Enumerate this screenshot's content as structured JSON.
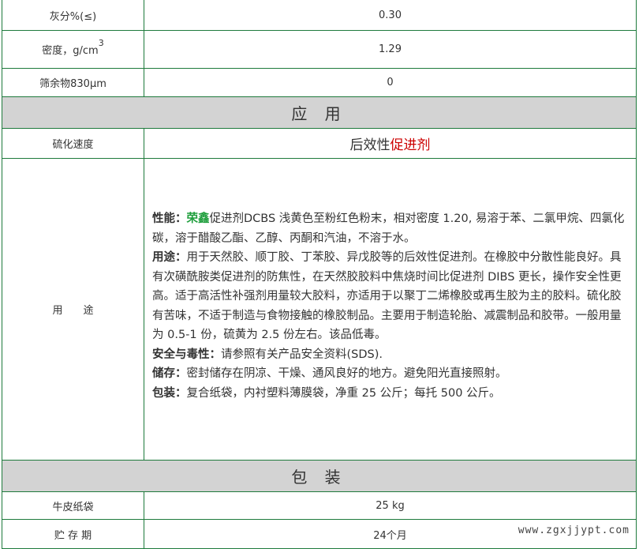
{
  "rows_top": [
    {
      "label": "灰分%(≤)",
      "value": "0.30"
    },
    {
      "label": "密度，g/cm",
      "sup": "3",
      "value": "1.29"
    },
    {
      "label": "筛余物830μm",
      "value": "0"
    }
  ],
  "section_application": "应 用",
  "vulcanization": {
    "label": "硫化速度",
    "value_a": "后效性",
    "value_b": "促进剂"
  },
  "usage": {
    "label": "用　　途",
    "p1_key": "性能：",
    "p1_brand": "荣鑫",
    "p1_text": "促进剂DCBS 浅黄色至粉红色粉末，相对密度 1.20, 易溶于苯、二氯甲烷、四氯化碳，溶于醋酸乙酯、乙醇、丙酮和汽油，不溶于水。",
    "p2_key": "用途：",
    "p2_text": "用于天然胶、顺丁胶、丁苯胶、异戊胶等的后效性促进剂。在橡胶中分散性能良好。具有次磺酰胺类促进剂的防焦性，在天然胶胶料中焦烧时间比促进剂 DIBS 更长，操作安全性更高。适于高活性补强剂用量较大胶料，亦适用于以聚丁二烯橡胶或再生胶为主的胶料。硫化胶有苦味，不适于制造与食物接触的橡胶制品。主要用于制造轮胎、减震制品和胶带。一般用量为 0.5-1 份，硫黄为 2.5 份左右。该品低毒。",
    "p3_key": "安全与毒性：",
    "p3_text": "请参照有关产品安全资料(SDS).",
    "p4_key": "储存：",
    "p4_text": "密封储存在阴凉、干燥、通风良好的地方。避免阳光直接照射。",
    "p5_key": "包装：",
    "p5_text": "复合纸袋，内衬塑料薄膜袋，净重 25 公斤；每托 500 公斤。"
  },
  "section_packaging": "包 装",
  "rows_bottom": [
    {
      "label": "牛皮纸袋",
      "value": "25 kg"
    },
    {
      "label": "贮 存 期",
      "value": "24个月"
    }
  ],
  "watermark": "www.zgxjjypt.com",
  "colors": {
    "border": "#1e7a3c",
    "section_bg": "#d3d3d3",
    "brand": "#1e9e3c",
    "accent_red": "#cc0000"
  }
}
